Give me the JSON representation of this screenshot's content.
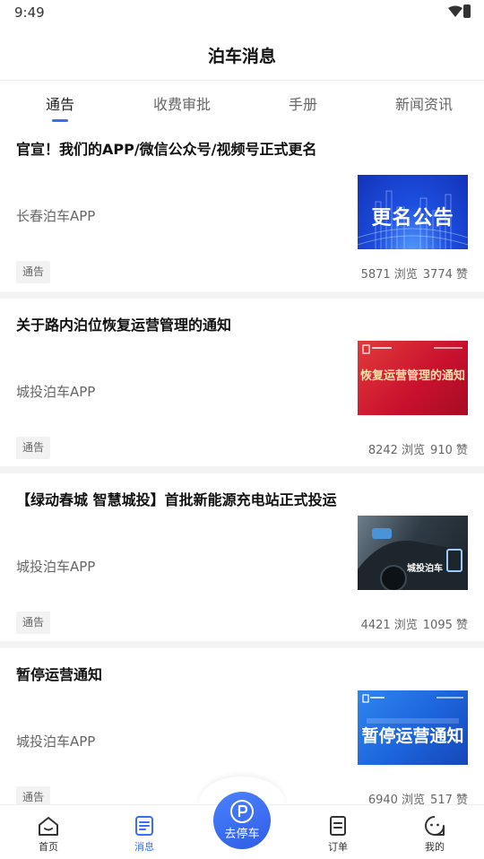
{
  "status_bar": {
    "time": "9:49"
  },
  "header": {
    "title": "泊车消息"
  },
  "tabs": [
    {
      "label": "通告",
      "active": true
    },
    {
      "label": "收费审批",
      "active": false
    },
    {
      "label": "手册",
      "active": false
    },
    {
      "label": "新闻资讯",
      "active": false
    }
  ],
  "articles": [
    {
      "title": "官宣！我们的APP/微信公众号/视频号正式更名",
      "source": "长春泊车APP",
      "tag": "通告",
      "views": "5871 浏览",
      "likes": "3774 赞",
      "thumb_text": "更名公告"
    },
    {
      "title": "关于路内泊位恢复运营管理的通知",
      "source": "城投泊车APP",
      "tag": "通告",
      "views": "8242 浏览",
      "likes": "910 赞",
      "thumb_text": "恢复运营管理的通知"
    },
    {
      "title": "【绿动春城 智慧城投】首批新能源充电站正式投运",
      "source": "城投泊车APP",
      "tag": "通告",
      "views": "4421 浏览",
      "likes": "1095 赞",
      "thumb_text": "城投泊车"
    },
    {
      "title": "暂停运营通知",
      "source": "城投泊车APP",
      "tag": "通告",
      "views": "6940 浏览",
      "likes": "517 赞",
      "thumb_text": "暂停运营通知"
    }
  ],
  "bottom_nav": {
    "home": "首页",
    "messages": "消息",
    "park": "去停车",
    "orders": "订单",
    "mine": "我的"
  },
  "colors": {
    "accent": "#3b6ef6",
    "tab_indicator": "#3b6ef6"
  }
}
